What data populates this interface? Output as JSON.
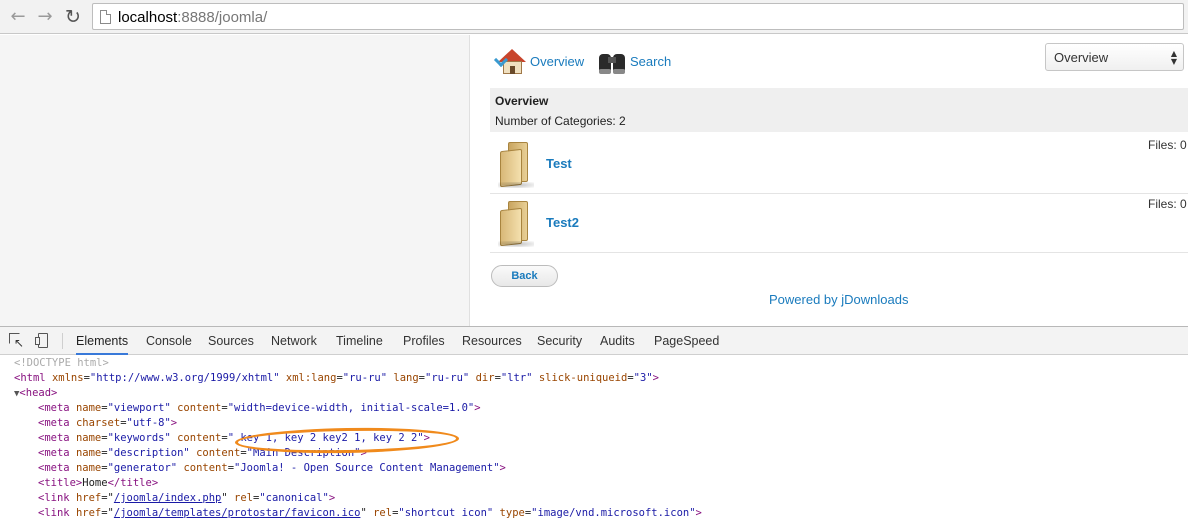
{
  "browser": {
    "url_host": "localhost",
    "url_rest": ":8888/joomla/"
  },
  "page": {
    "nav": {
      "overview_label": "Overview",
      "search_label": "Search"
    },
    "select": {
      "selected": "Overview"
    },
    "overview": {
      "heading": "Overview",
      "count_text": "Number of Categories: 2"
    },
    "categories": [
      {
        "title": "Test",
        "files": "Files: 0"
      },
      {
        "title": "Test2",
        "files": "Files: 0"
      }
    ],
    "back_label": "Back",
    "powered_by": "Powered by jDownloads"
  },
  "devtools": {
    "tabs": [
      "Elements",
      "Console",
      "Sources",
      "Network",
      "Timeline",
      "Profiles",
      "Resources",
      "Security",
      "Audits",
      "PageSpeed"
    ],
    "active_tab": "Elements",
    "lines": {
      "doctype": "<!DOCTYPE html>",
      "html": {
        "tag": "html",
        "a1": "xmlns",
        "v1": "\"http://www.w3.org/1999/xhtml\"",
        "a2": "xml:lang",
        "v2": "\"ru-ru\"",
        "a3": "lang",
        "v3": "\"ru-ru\"",
        "a4": "dir",
        "v4": "\"ltr\"",
        "a5": "slick-uniqueid",
        "v5": "\"3\""
      },
      "head": "head",
      "meta_viewport": {
        "a1": "name",
        "v1": "\"viewport\"",
        "a2": "content",
        "v2": "\"width=device-width, initial-scale=1.0\""
      },
      "meta_charset": {
        "a1": "charset",
        "v1": "\"utf-8\""
      },
      "meta_keywords": {
        "a1": "name",
        "v1": "\"keywords\"",
        "a2": "content",
        "v2": "\" key 1, key 2 key2 1, key 2 2\""
      },
      "meta_description": {
        "a1": "name",
        "v1": "\"description\"",
        "a2": "content",
        "v2": "\"Main Description\""
      },
      "meta_generator": {
        "a1": "name",
        "v1": "\"generator\"",
        "a2": "content",
        "v2": "\"Joomla! - Open Source Content Management\""
      },
      "title_text": "Home",
      "link_canonical": {
        "href": "/joomla/index.php",
        "a2": "rel",
        "v2": "\"canonical\""
      },
      "link_icon": {
        "href": "/joomla/templates/protostar/favicon.ico",
        "a2": "rel",
        "v2": "\"shortcut icon\"",
        "a3": "type",
        "v3": "\"image/vnd.microsoft.icon\""
      }
    }
  },
  "colors": {
    "link": "#1a7bbd",
    "annotation": "#f08a1c",
    "tab_active": "#3879d9"
  }
}
